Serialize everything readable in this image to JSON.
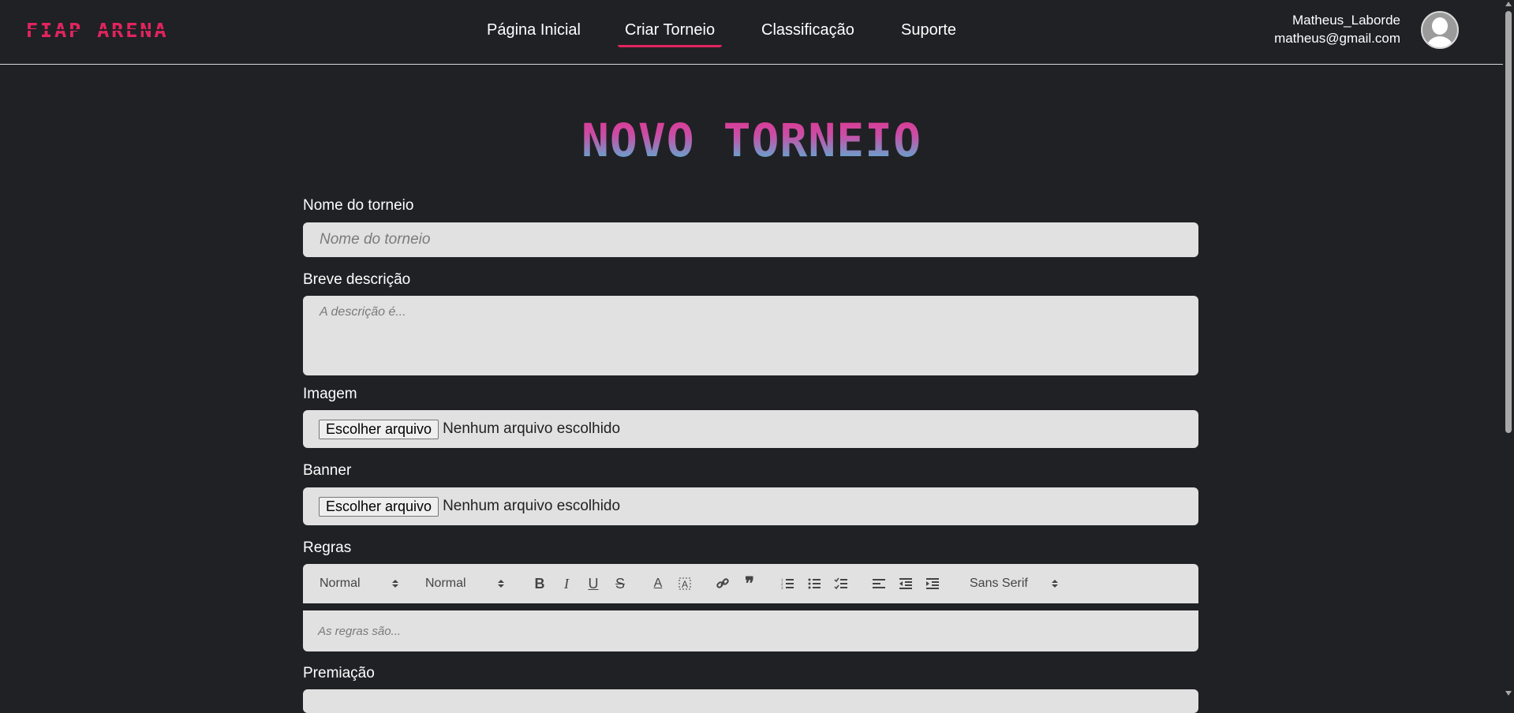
{
  "header": {
    "logo": "FIAP ARENA",
    "nav": [
      {
        "label": "Página Inicial"
      },
      {
        "label": "Criar Torneio"
      },
      {
        "label": "Classificação"
      },
      {
        "label": "Suporte"
      }
    ],
    "active_nav": "Criar Torneio",
    "user": {
      "name": "Matheus_Laborde",
      "email": "matheus@gmail.com",
      "avatar_icon": "user-avatar-icon"
    }
  },
  "page": {
    "title": "NOVO TORNEIO"
  },
  "form": {
    "name": {
      "label": "Nome do torneio",
      "placeholder": "Nome do torneio",
      "value": ""
    },
    "description": {
      "label": "Breve descrição",
      "placeholder": "A descrição é...",
      "value": ""
    },
    "image": {
      "label": "Imagem",
      "button": "Escolher arquivo",
      "status": "Nenhum arquivo escolhido"
    },
    "banner": {
      "label": "Banner",
      "button": "Escolher arquivo",
      "status": "Nenhum arquivo escolhido"
    },
    "rules": {
      "label": "Regras",
      "toolbar": {
        "header_select": "Normal",
        "size_select": "Normal",
        "font_select": "Sans Serif",
        "buttons": [
          "bold-icon",
          "italic-icon",
          "underline-icon",
          "strike-icon",
          "text-color-icon",
          "background-color-icon",
          "link-icon",
          "blockquote-icon",
          "ordered-list-icon",
          "bullet-list-icon",
          "check-list-icon",
          "align-icon",
          "outdent-icon",
          "indent-icon"
        ]
      },
      "placeholder": "As regras são..."
    },
    "prize": {
      "label": "Premiação"
    }
  },
  "colors": {
    "background": "#202125",
    "accent": "#e2245e",
    "field": "#e1e1e1",
    "title_gradient_top": "#e2338c",
    "title_gradient_bottom": "#3fc5dc"
  }
}
